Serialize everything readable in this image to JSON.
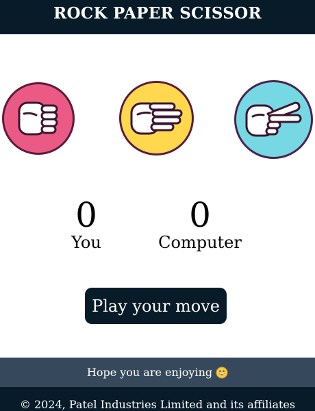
{
  "header": {
    "title": "ROCK PAPER SCISSOR"
  },
  "choices": [
    {
      "id": "rock",
      "icon": "fist-icon",
      "color": "#ea5a85"
    },
    {
      "id": "paper",
      "icon": "open-hand-icon",
      "color": "#ffd84d"
    },
    {
      "id": "scissors",
      "icon": "scissors-hand-icon",
      "color": "#76d8e2"
    }
  ],
  "scoreboard": {
    "user": {
      "score": "0",
      "label": "You"
    },
    "computer": {
      "score": "0",
      "label": "Computer"
    }
  },
  "play_button": {
    "label": "Play your move"
  },
  "footer": {
    "message": "Hope you are enjoying",
    "emoji": "grinning-face-icon",
    "copyright": "© 2024, Patel Industries Limited and its affiliates"
  },
  "colors": {
    "header_bg": "#081b29",
    "footer_top_bg": "#36495c"
  }
}
